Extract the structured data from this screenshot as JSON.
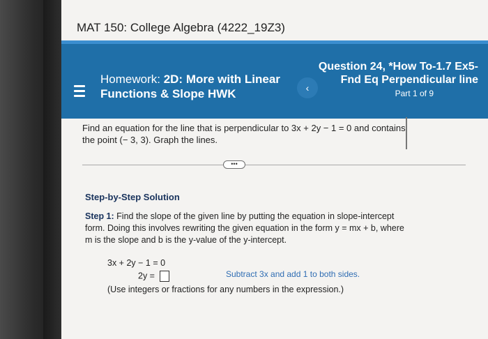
{
  "course_title": "MAT 150: College Algebra (4222_19Z3)",
  "header": {
    "hw_prefix": "Homework:",
    "hw_title": "2D: More with Linear Functions & Slope HWK",
    "back_symbol": "‹",
    "question_title": "Question 24, *How To-1.7 Ex5-Fnd Eq Perpendicular line",
    "part_label": "Part 1 of 9"
  },
  "problem_text": "Find an equation for the line that is perpendicular to 3x + 2y − 1 = 0 and contains the point (− 3, 3). Graph the lines.",
  "more_button": "•••",
  "steps": {
    "title": "Step-by-Step Solution",
    "step1_label": "Step 1:",
    "step1_text": "Find the slope of the given line by putting the equation in slope-intercept form. Doing this involves rewriting the given equation in the form y = mx + b, where m is the slope and b is the y-value of the y-intercept.",
    "eq1": "3x + 2y − 1 = 0",
    "eq2_left": "2y =",
    "hint": "Subtract 3x and add 1 to both sides.",
    "note": "(Use integers or fractions for any numbers in the expression.)"
  },
  "icons": {
    "menu": "hamburger-menu-icon",
    "back": "chevron-left-icon"
  },
  "colors": {
    "header": "#1f6fa8",
    "header_accent": "#3b8ed0",
    "step_title": "#18325c",
    "hint": "#2f6db3"
  }
}
